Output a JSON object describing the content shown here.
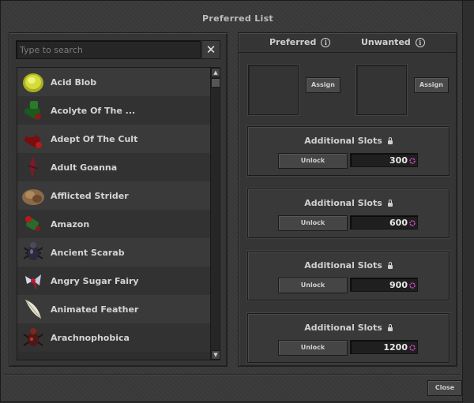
{
  "window": {
    "title": "Preferred List"
  },
  "search": {
    "placeholder": "Type to search",
    "clear_icon": "close-icon"
  },
  "list": {
    "items": [
      {
        "name": "Acid Blob",
        "icon": "acid-blob-icon"
      },
      {
        "name": "Acolyte Of The ...",
        "icon": "acolyte-icon"
      },
      {
        "name": "Adept Of The Cult",
        "icon": "adept-icon"
      },
      {
        "name": "Adult Goanna",
        "icon": "goanna-icon"
      },
      {
        "name": "Afflicted Strider",
        "icon": "strider-icon"
      },
      {
        "name": "Amazon",
        "icon": "amazon-icon"
      },
      {
        "name": "Ancient Scarab",
        "icon": "scarab-icon"
      },
      {
        "name": "Angry Sugar Fairy",
        "icon": "fairy-icon"
      },
      {
        "name": "Animated Feather",
        "icon": "feather-icon"
      },
      {
        "name": "Arachnophobica",
        "icon": "arachnophobica-icon"
      }
    ]
  },
  "right": {
    "preferred_label": "Preferred",
    "unwanted_label": "Unwanted",
    "assign_label": "Assign",
    "slots": [
      {
        "title": "Additional Slots",
        "unlock_label": "Unlock",
        "price": "300"
      },
      {
        "title": "Additional Slots",
        "unlock_label": "Unlock",
        "price": "600"
      },
      {
        "title": "Additional Slots",
        "unlock_label": "Unlock",
        "price": "900"
      },
      {
        "title": "Additional Slots",
        "unlock_label": "Unlock",
        "price": "1200"
      }
    ]
  },
  "footer": {
    "close_label": "Close"
  },
  "colors": {
    "background": "#3a3a3a",
    "panel": "#353535",
    "text": "#d4d4d4"
  }
}
